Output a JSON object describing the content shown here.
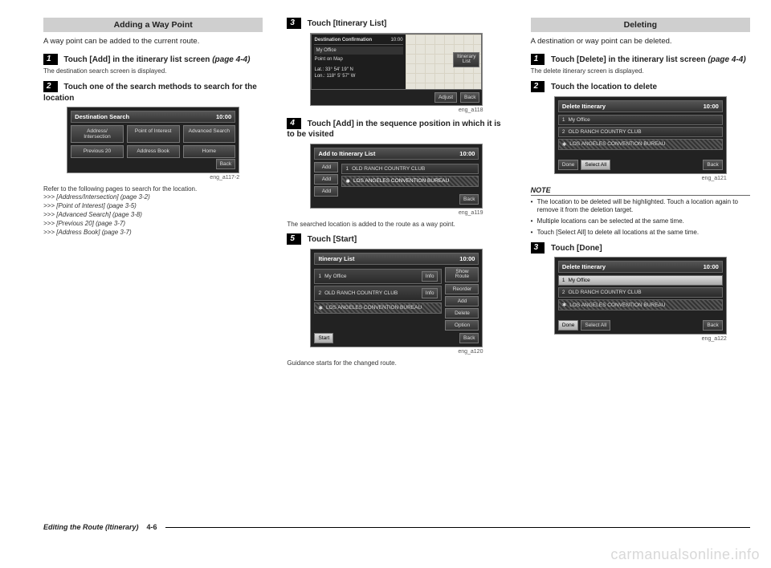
{
  "col1": {
    "heading": "Adding a Way Point",
    "intro": "A way point can be added to the current route.",
    "step1_a": "Touch [Add] in the itinerary list screen ",
    "step1_ref": "(page 4-4)",
    "step1_sub": "The destination search screen is displayed.",
    "step2": "Touch one of the search methods to search for the location",
    "ss1": {
      "title": "Destination Search",
      "time": "10:00",
      "b1": "Address/\nIntersection",
      "b2": "Point of\nInterest",
      "b3": "Advanced\nSearch",
      "b4": "Previous\n20",
      "b5": "Address\nBook",
      "b6": "Home",
      "back": "Back"
    },
    "cap1": "eng_a117-2",
    "refIntro": "Refer to the following pages to search for the location.",
    "ref1": ">>> [Address/Intersection] (page 3-2)",
    "ref2": ">>> [Point of Interest] (page 3-5)",
    "ref3": ">>> [Advanced Search] (page 3-8)",
    "ref4": ">>> [Previous 20] (page 3-7)",
    "ref5": ">>> [Address Book] (page 3-7)"
  },
  "col2": {
    "step3": "Touch [Itinerary List]",
    "ss2": {
      "title": "Destination Confirmation",
      "time": "10:00",
      "line1": "My Office",
      "line2": "Point on Map",
      "line3": "Lat.: 33° 54' 19\" N",
      "line4": "Lon.: 118° 5' 57\" W",
      "itin": "Itinerary\nList",
      "adjust": "Adjust",
      "back": "Back"
    },
    "cap2": "eng_a118",
    "step4": "Touch [Add] in the sequence position in which it is to be visited",
    "ss3": {
      "title": "Add to Itinerary List",
      "time": "10:00",
      "add": "Add",
      "r1": "OLD RANCH COUNTRY CLUB",
      "r2": "LOS ANGELES CONVENTION BUREAU",
      "back": "Back"
    },
    "cap3": "eng_a119",
    "note4": "The searched location is added to the route as a way point.",
    "step5": "Touch [Start]",
    "ss4": {
      "title": "Itinerary List",
      "time": "10:00",
      "r1": "My Office",
      "r2": "OLD RANCH COUNTRY CLUB",
      "r3": "LOS ANGELES CONVENTION BUREAU",
      "info": "Info",
      "show": "Show\nRoute",
      "reorder": "Reorder",
      "addb": "Add",
      "delete": "Delete",
      "option": "Option",
      "start": "Start",
      "back": "Back"
    },
    "cap4": "eng_a120",
    "note5": "Guidance starts for the changed route."
  },
  "col3": {
    "heading": "Deleting",
    "intro": "A destination or way point can be deleted.",
    "step1_a": "Touch [Delete] in the itinerary list screen ",
    "step1_ref": "(page 4-4)",
    "step1_sub": "The delete itinerary screen is displayed.",
    "step2": "Touch the location to delete",
    "ss5": {
      "title": "Delete Itinerary",
      "time": "10:00",
      "r1": "My Office",
      "r2": "OLD RANCH COUNTRY CLUB",
      "r3": "LOS ANGELES CONVENTION BUREAU",
      "done": "Done",
      "selall": "Select All",
      "back": "Back"
    },
    "cap5": "eng_a121",
    "noteHead": "NOTE",
    "n1": "The location to be deleted will be highlighted. Touch a location again to remove it from the deletion target.",
    "n2": "Multiple locations can be selected at the same time.",
    "n3": "Touch [Select All] to delete all locations at the same time.",
    "step3": "Touch [Done]",
    "ss6": {
      "title": "Delete Itinerary",
      "time": "10:00",
      "r1": "My Office",
      "r2": "OLD RANCH COUNTRY CLUB",
      "r3": "LOS ANGELES CONVENTION BUREAU",
      "done": "Done",
      "selall": "Select All",
      "back": "Back"
    },
    "cap6": "eng_a122"
  },
  "footer": {
    "title": "Editing the Route (Itinerary)",
    "page": "4-6"
  },
  "watermark": "carmanualsonline.info",
  "nums": {
    "n1": "1",
    "n2": "2",
    "n3": "3",
    "n4": "4",
    "n5": "5"
  }
}
